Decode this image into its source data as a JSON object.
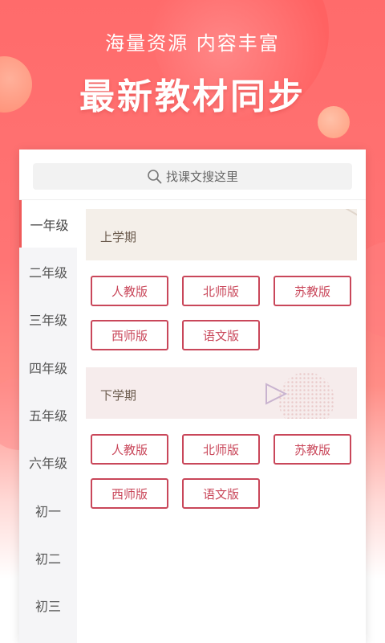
{
  "hero": {
    "slogan": "海量资源 内容丰富",
    "headline": "最新教材同步"
  },
  "search": {
    "placeholder": "找课文搜这里",
    "icon": "search-icon"
  },
  "sidebar": {
    "active_index": 0,
    "items": [
      "一年级",
      "二年级",
      "三年级",
      "四年级",
      "五年级",
      "六年级",
      "初一",
      "初二",
      "初三"
    ]
  },
  "terms": [
    {
      "label": "上学期",
      "versions": [
        "人教版",
        "北师版",
        "苏教版",
        "西师版",
        "语文版"
      ]
    },
    {
      "label": "下学期",
      "versions": [
        "人教版",
        "北师版",
        "苏教版",
        "西师版",
        "语文版"
      ]
    }
  ],
  "colors": {
    "accent": "#f05a5a",
    "button_border": "#c9475a",
    "hero_top": "#ff6b6b"
  }
}
